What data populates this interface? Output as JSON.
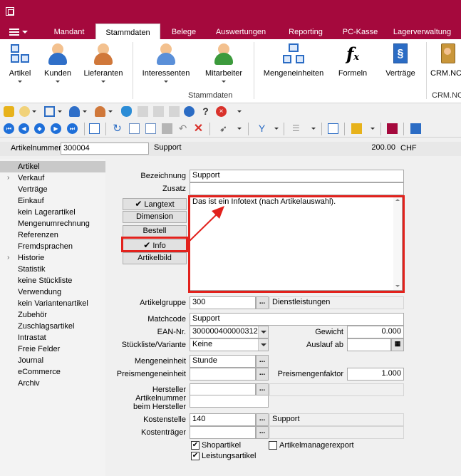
{
  "ribbon": {
    "tabs": [
      "Mandant",
      "Stammdaten",
      "Belege",
      "Auswertungen",
      "Reporting",
      "PC-Kasse",
      "Lagerverwaltung"
    ],
    "active_tab": "Stammdaten",
    "buttons": {
      "artikel": "Artikel",
      "kunden": "Kunden",
      "lieferanten": "Lieferanten",
      "interessenten": "Interessenten",
      "mitarbeiter": "Mitarbeiter",
      "mengeneinheiten": "Mengeneinheiten",
      "formeln": "Formeln",
      "vertraege": "Verträge",
      "crm": "CRM.NC"
    },
    "groups": {
      "stammdaten": "Stammdaten",
      "crm": "CRM.NC"
    }
  },
  "header": {
    "label": "Artikelnummer",
    "number": "300004",
    "name": "Support",
    "price": "200.00",
    "currency": "CHF"
  },
  "nav": {
    "items": [
      {
        "label": "Artikel",
        "arrow": false,
        "selected": true
      },
      {
        "label": "Verkauf",
        "arrow": true,
        "selected": false
      },
      {
        "label": "Verträge",
        "arrow": false,
        "selected": false
      },
      {
        "label": "Einkauf",
        "arrow": false,
        "selected": false
      },
      {
        "label": "kein Lagerartikel",
        "arrow": false,
        "selected": false
      },
      {
        "label": "Mengenumrechnung",
        "arrow": false,
        "selected": false
      },
      {
        "label": "Referenzen",
        "arrow": false,
        "selected": false
      },
      {
        "label": "Fremdsprachen",
        "arrow": false,
        "selected": false
      },
      {
        "label": "Historie",
        "arrow": true,
        "selected": false
      },
      {
        "label": "Statistik",
        "arrow": false,
        "selected": false
      },
      {
        "label": "keine Stückliste",
        "arrow": false,
        "selected": false
      },
      {
        "label": "Verwendung",
        "arrow": false,
        "selected": false
      },
      {
        "label": "kein Variantenartikel",
        "arrow": false,
        "selected": false
      },
      {
        "label": "Zubehör",
        "arrow": false,
        "selected": false
      },
      {
        "label": "Zuschlagsartikel",
        "arrow": false,
        "selected": false
      },
      {
        "label": "Intrastat",
        "arrow": false,
        "selected": false
      },
      {
        "label": "Freie Felder",
        "arrow": false,
        "selected": false
      },
      {
        "label": "Journal",
        "arrow": false,
        "selected": false
      },
      {
        "label": "eCommerce",
        "arrow": false,
        "selected": false
      },
      {
        "label": "Archiv",
        "arrow": false,
        "selected": false
      }
    ]
  },
  "form": {
    "bezeichnung_label": "Bezeichnung",
    "bezeichnung": "Support",
    "zusatz_label": "Zusatz",
    "zusatz": "",
    "buttons": {
      "langtext": "Langtext",
      "dimension": "Dimension",
      "bestell": "Bestell",
      "info": "Info",
      "artikelbild": "Artikelbild"
    },
    "info_text": "Das ist ein Infotext (nach Artikelauswahl).",
    "artikelgruppe_label": "Artikelgruppe",
    "artikelgruppe": "300",
    "artikelgruppe_name": "Dienstleistungen",
    "matchcode_label": "Matchcode",
    "matchcode": "Support",
    "ean_label": "EAN-Nr.",
    "ean": "300000400000312",
    "gewicht_label": "Gewicht",
    "gewicht": "0.000",
    "stueckliste_label": "Stückliste/Variante",
    "stueckliste": "Keine",
    "auslauf_label": "Auslauf ab",
    "auslauf": "",
    "mengeneinheit_label": "Mengeneinheit",
    "mengeneinheit": "Stunde",
    "preismengeneinheit_label": "Preismengeneinheit",
    "preismengeneinheit": "",
    "preismengenfaktor_label": "Preismengenfaktor",
    "preismengenfaktor": "1.000",
    "hersteller_label": "Hersteller",
    "hersteller": "",
    "herstellernr_label_1": "Artikelnummer",
    "herstellernr_label_2": "beim Hersteller",
    "herstellernr": "",
    "kostenstelle_label": "Kostenstelle",
    "kostenstelle": "140",
    "kostenstelle_name": "Support",
    "kostentraeger_label": "Kostenträger",
    "kostentraeger": "",
    "checkboxes": {
      "shopartikel": {
        "label": "Shopartikel",
        "checked": true
      },
      "leistungsartikel": {
        "label": "Leistungsartikel",
        "checked": true
      },
      "artikelmanagerexport": {
        "label": "Artikelmanagerexport",
        "checked": false
      }
    }
  },
  "colors": {
    "brand": "#a5093d",
    "highlight": "#e2211c",
    "toolbar_blue": "#1e6fd9"
  },
  "icons": [
    "app-icon",
    "file-menu-icon",
    "artikel-icon",
    "kunden-icon",
    "lieferanten-icon",
    "interessenten-icon",
    "mitarbeiter-icon",
    "mengeneinheiten-icon",
    "formeln-icon",
    "vertraege-icon",
    "crm-icon",
    "first-record-icon",
    "previous-record-icon",
    "search-record-icon",
    "next-record-icon",
    "last-record-icon",
    "calendar-icon"
  ]
}
